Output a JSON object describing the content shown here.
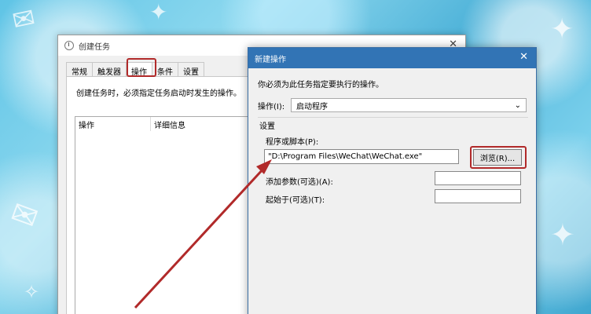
{
  "back_window": {
    "title": "创建任务",
    "tabs": [
      {
        "label": "常规"
      },
      {
        "label": "触发器"
      },
      {
        "label": "操作"
      },
      {
        "label": "条件"
      },
      {
        "label": "设置"
      }
    ],
    "hint": "创建任务时，必须指定任务启动时发生的操作。",
    "columns": [
      "操作",
      "详细信息"
    ]
  },
  "dialog": {
    "title": "新建操作",
    "prompt": "你必须为此任务指定要执行的操作。",
    "action_label": "操作(I):",
    "action_value": "启动程序",
    "settings_title": "设置",
    "program_label": "程序或脚本(P):",
    "program_value": "\"D:\\Program Files\\WeChat\\WeChat.exe\"",
    "browse_label": "浏览(R)...",
    "args_label": "添加参数(可选)(A):",
    "start_label": "起始于(可选)(T):"
  },
  "colors": {
    "highlight": "#b12a2a",
    "dialog_titlebar": "#3274b5"
  }
}
